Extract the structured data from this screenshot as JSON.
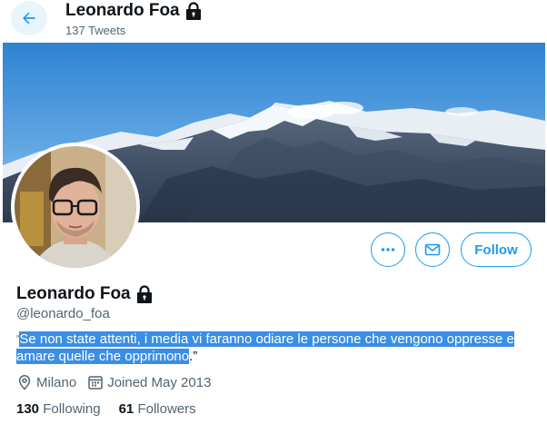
{
  "header": {
    "name": "Leonardo Foa",
    "tweets": "137 Tweets"
  },
  "profile": {
    "name": "Leonardo Foa",
    "handle": "@leonardo_foa",
    "bio_open_quote": "“",
    "bio_selected": "Se non state attenti, i media vi faranno odiare le persone che vengono oppresse e amare quelle che opprimono",
    "bio_close": ".”",
    "location": "Milano",
    "joined": "Joined May 2013",
    "following_count": "130",
    "following_label": "Following",
    "followers_count": "61",
    "followers_label": "Followers"
  },
  "actions": {
    "more_icon": "more-icon",
    "message_icon": "mail-icon",
    "follow_label": "Follow"
  },
  "colors": {
    "accent": "#1d9bf0",
    "selection": "#3a8ee6",
    "secondary_text": "#536471"
  }
}
